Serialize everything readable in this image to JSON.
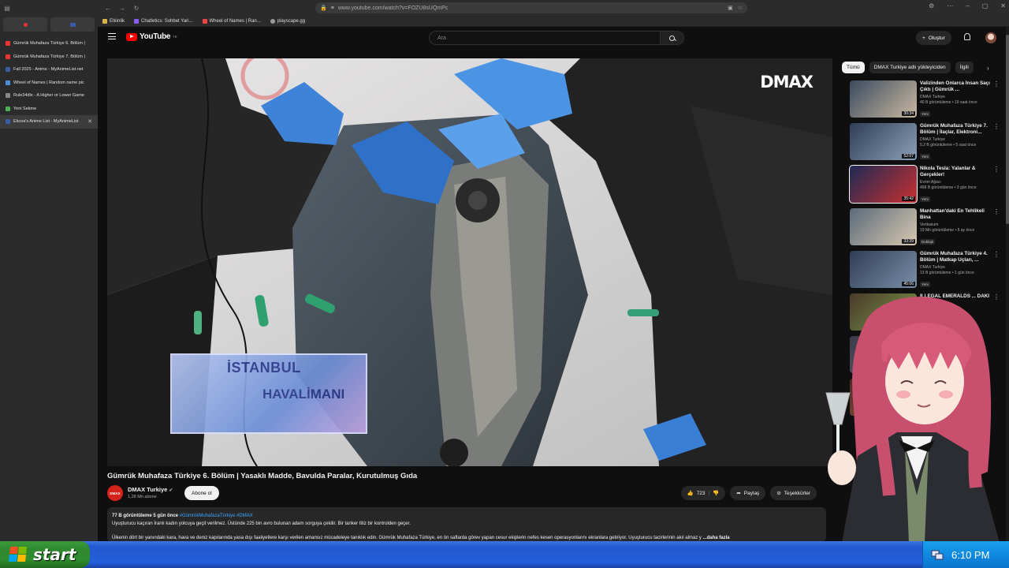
{
  "browser": {
    "url": "www.youtube.com/watch?v=FOZU8sUQmPc",
    "bookmarks": [
      "Etkinlik",
      "Chatletics: Sohbet Yari...",
      "Wheel of Names | Ran...",
      "playscape.gg"
    ],
    "tabs": [
      {
        "label": "Gümrük Muhafaza Türkiye 6. Bölüm |",
        "color": "#e33"
      },
      {
        "label": "Gümrük Muhafaza Türkiye 7. Bölüm |",
        "color": "#e33"
      },
      {
        "label": "Fall 2025 - Anime - MyAnimeList.net",
        "color": "#3b5ba8"
      },
      {
        "label": "Wheel of Names | Random name pic",
        "color": "#4a90d9"
      },
      {
        "label": "Rule34dle - A Higher or Lower Game",
        "color": "#888"
      },
      {
        "label": "Yeni Sekme",
        "color": "#4caf50"
      },
      {
        "label": "Ekcoa's Anime List - MyAnimeList",
        "color": "#3b5ba8"
      }
    ]
  },
  "yt": {
    "logo": "YouTube",
    "logo_sup": "TR",
    "search_placeholder": "Ara",
    "create_label": "Oluştur"
  },
  "video": {
    "watermark": "DMAX",
    "overlay_line1": "İSTANBUL",
    "overlay_line2": "HAVALİMANI",
    "title": "Gümrük Muhafaza Türkiye 6. Bölüm | Yasaklı Madde, Bavulda Paralar, Kurutulmuş Gıda",
    "channel": "DMAX Turkiye",
    "subs": "1,28 Mn abone",
    "subscribe": "Abone ol",
    "likes": "723",
    "share": "Paylaş",
    "thanks": "Teşekkürler",
    "views_date": "77 B görüntüleme  5 gün önce",
    "tags": "#GümrükMuhafazaTürkiye #DMAX",
    "desc_line1": "Uyuşturucu kaçıran İranlı kadın yolcuya geçit verilmez. Üstünde 225 bin avro bulunan adam sorguya çekilir. Bir tanker titiz bir kontrolden geçer.",
    "desc_line2": "Ülkenin dört bir yanındaki kara, hava ve deniz kapılarında yasa dışı faaliyetlere karşı verilen amansız mücadeleye tanıklık edin. Gümrük Muhafaza Türkiye, en ön saflarda görev yapan cesur ekiplerin nefes kesen operasyonlarını ekranlara getiriyor. Uyuşturucu tacirlerinin akıl almaz y",
    "more": "...daha fazla"
  },
  "chips": [
    "Tümü",
    "DMAX Turkiye adlı yükleyiciden",
    "İlgili"
  ],
  "recs": [
    {
      "title": "Valizinden Onlarca İnsan Saçı Çıktı | Gümrük ...",
      "channel": "DMAX Turkiye",
      "views": "40 B görüntüleme • 19 saat önce",
      "badge": "Yeni",
      "dur": "30:34",
      "c1": "#3a4a5e",
      "c2": "#c9b8a0"
    },
    {
      "title": "Gümrük Muhafaza Türkiye 7. Bölüm | İlaçlar, Elektroni...",
      "channel": "DMAX Turkiye",
      "views": "5,2 B görüntüleme • 5 saat önce",
      "badge": "Yeni",
      "dur": "52:07",
      "c1": "#2e3e55",
      "c2": "#8aa0b8"
    },
    {
      "title": "Nikola Tesla: Yalanlar & Gerçekler!",
      "channel": "Evrim Ağacı",
      "views": "468 B görüntüleme • 3 gün önce",
      "badge": "Yeni",
      "dur": "35:42",
      "c1": "#1e2a55",
      "c2": "#c83030"
    },
    {
      "title": "Manhattan'daki En Tehlikeli Bina",
      "channel": "Veritasium",
      "views": "19 Mn görüntüleme • 5 ay önce",
      "badge": "Dublajlı",
      "dur": "33:39",
      "c1": "#5a6a7a",
      "c2": "#d8c8b0"
    },
    {
      "title": "Gümrük Muhafaza Türkiye 4. Bölüm | Matkap Uçları, ...",
      "channel": "DMAX Turkiye",
      "views": "13 B görüntüleme • 1 gün önce",
      "badge": "Yeni",
      "dur": "45:06",
      "c1": "#2e3e55",
      "c2": "#7a8ea8"
    },
    {
      "title": "İLLEGAL EMERALDS ... DAKİ ZÜMRÜT",
      "channel": "",
      "views": "...nce",
      "badge": "",
      "dur": "",
      "c1": "#4a3a2a",
      "c2": "#7a9a4a"
    },
    {
      "title": "",
      "channel": "",
      "views": "",
      "badge": "",
      "dur": "",
      "c1": "#3a3a4a",
      "c2": "#6a6a7a"
    },
    {
      "title": "",
      "channel": "",
      "views": "",
      "badge": "",
      "dur": "",
      "c1": "#4a2a2a",
      "c2": "#a86a3a"
    }
  ],
  "taskbar": {
    "start": "start",
    "clock": "6:10 PM"
  }
}
